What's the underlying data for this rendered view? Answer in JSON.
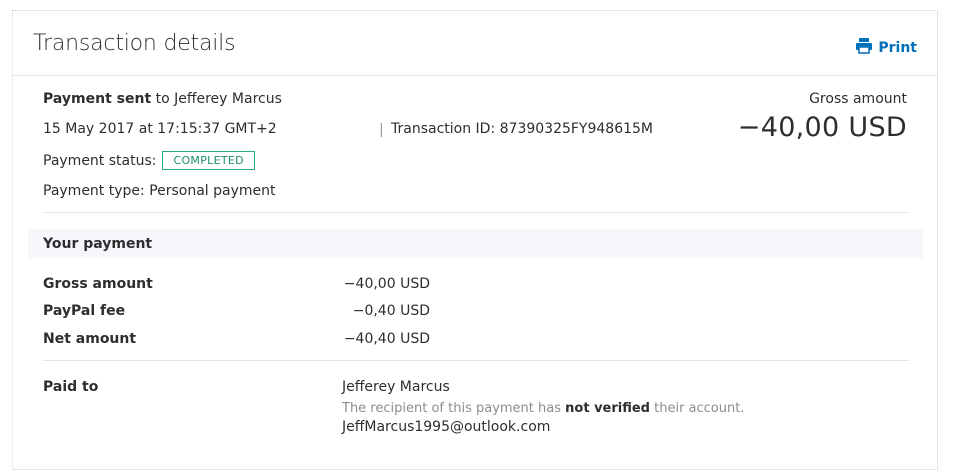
{
  "header": {
    "title": "Transaction details",
    "print_label": "Print"
  },
  "summary": {
    "direction": "Payment sent",
    "to_prefix": "to",
    "recipient": "Jefferey Marcus",
    "datetime": "15 May 2017 at 17:15:37 GMT+2",
    "divider": "|",
    "transaction_id_label": "Transaction ID:",
    "transaction_id": "87390325FY948615M",
    "status_label": "Payment status:",
    "status": "COMPLETED",
    "type_label": "Payment type:",
    "type": "Personal payment",
    "gross_label": "Gross amount",
    "gross_value": "−40,00 USD"
  },
  "your_payment": {
    "section_label": "Your payment",
    "rows": [
      {
        "label": "Gross amount",
        "value": "−40,00 USD"
      },
      {
        "label": "PayPal fee",
        "value": "−0,40 USD"
      },
      {
        "label": "Net amount",
        "value": "−40,40 USD"
      }
    ]
  },
  "paid_to": {
    "label": "Paid to",
    "name": "Jefferey Marcus",
    "note_prefix": "The recipient of this payment has",
    "note_bold": "not verified",
    "note_suffix": "their account.",
    "email": "JeffMarcus1995@outlook.com"
  },
  "colors": {
    "accent": "#0070ba",
    "status_green": "#28a883",
    "band_bg": "#f5f7fa"
  }
}
